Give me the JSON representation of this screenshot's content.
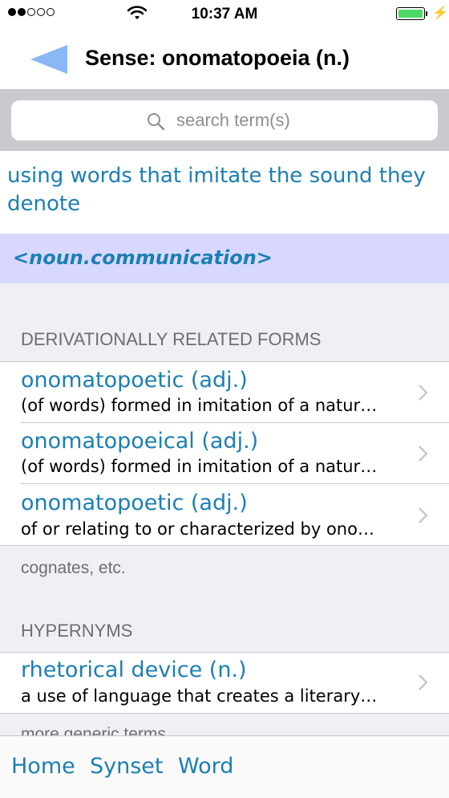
{
  "status": {
    "time": "10:37 AM",
    "signal_dots": 5,
    "signal_filled": 2,
    "battery_level": 1.0,
    "charging": true,
    "colors": {
      "battery": "#4cd964"
    }
  },
  "nav": {
    "title": "Sense: onomatopoeia (n.)",
    "back_icon": "back-triangle-icon",
    "colors": {
      "back": "#8ab7f5"
    }
  },
  "search": {
    "placeholder": "search term(s)",
    "value": ""
  },
  "definition": "using words that imitate the sound they denote",
  "lexname": "<noun.communication>",
  "sections": {
    "derivational": {
      "header": "DERIVATIONALLY RELATED FORMS",
      "footer": "cognates, etc.",
      "rows": [
        {
          "term": "onomatopoetic (adj.)",
          "gloss": "(of words) formed in imitation of a natur…"
        },
        {
          "term": "onomatopoeical (adj.)",
          "gloss": "(of words) formed in imitation of a natur…"
        },
        {
          "term": "onomatopoetic (adj.)",
          "gloss": "of or relating to or characterized by ono…"
        }
      ]
    },
    "hypernyms": {
      "header": "HYPERNYMS",
      "footer": "more generic terms",
      "rows": [
        {
          "term": "rhetorical device (n.)",
          "gloss": "a use of language that creates a literary…"
        }
      ]
    }
  },
  "tabs": {
    "home": "Home",
    "synset": "Synset",
    "word": "Word"
  },
  "colors": {
    "link": "#1b7fb3",
    "lexname_bg": "#d8d8ff",
    "group_bg": "#efeff4",
    "searchbar_bg": "#c9c9ce"
  }
}
